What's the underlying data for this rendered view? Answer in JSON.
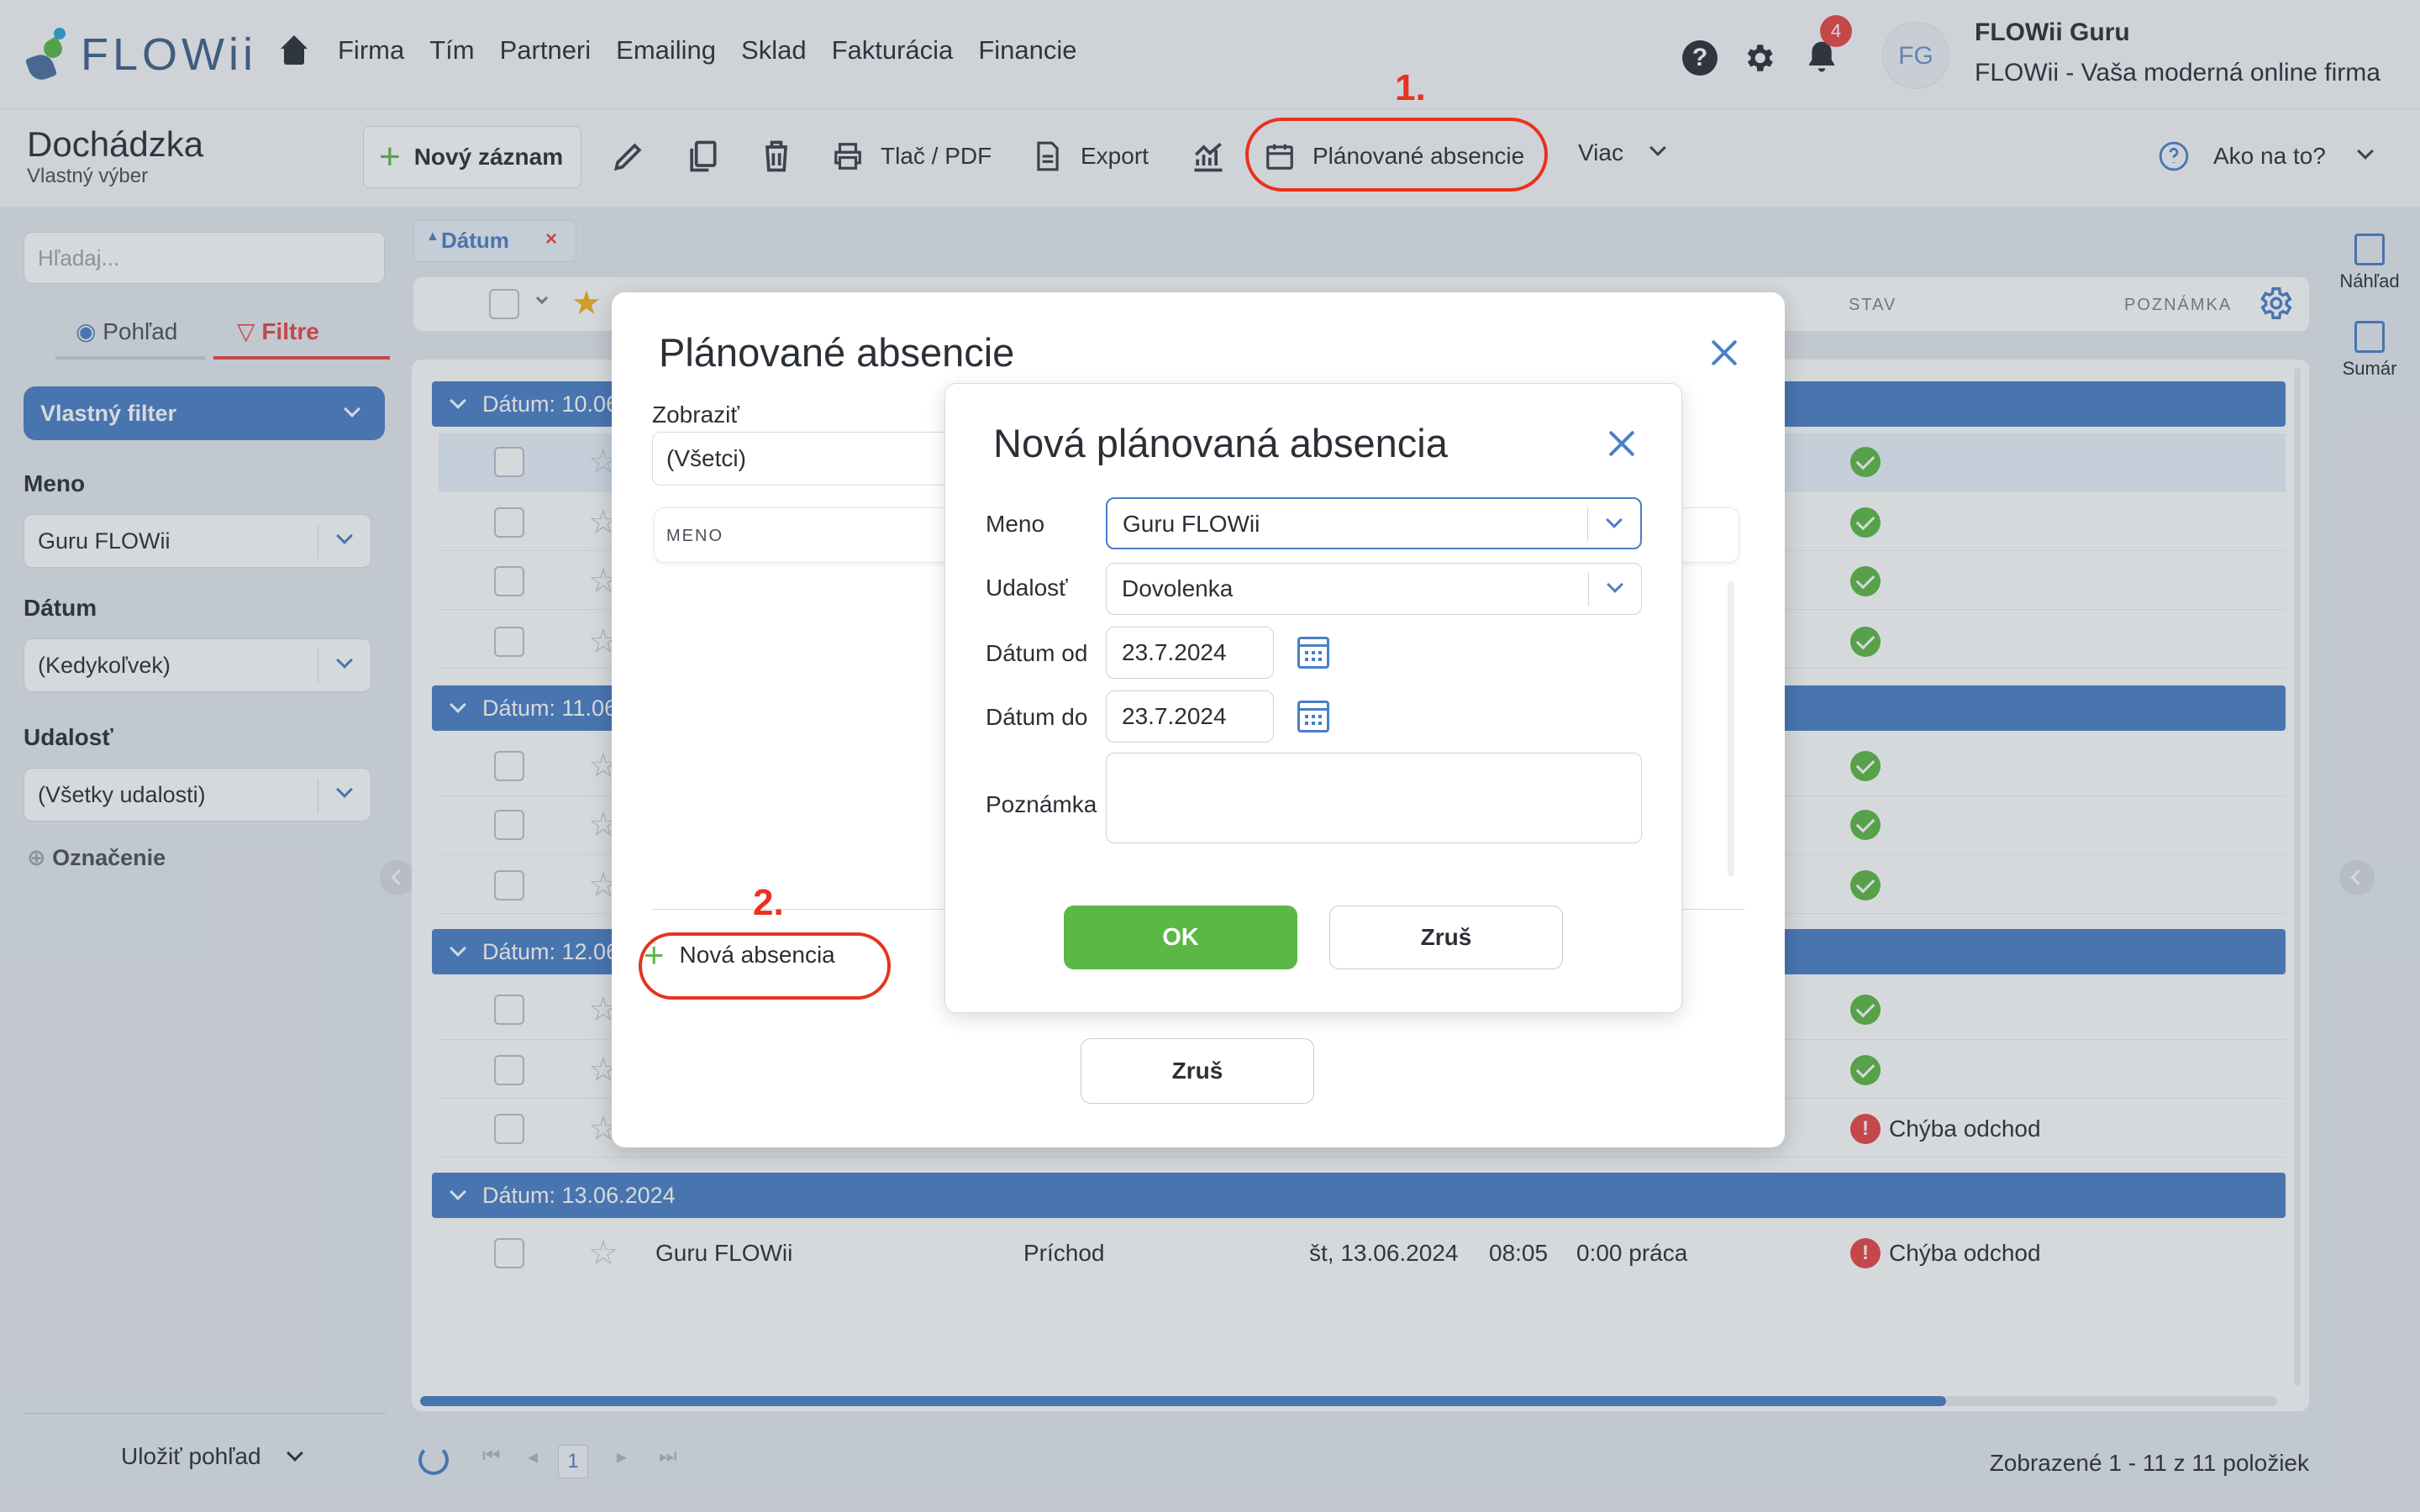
{
  "brand": {
    "logo_text": "FLOWii"
  },
  "nav": {
    "items": [
      "Firma",
      "Tím",
      "Partneri",
      "Emailing",
      "Sklad",
      "Fakturácia",
      "Financie"
    ]
  },
  "user": {
    "notifications": "4",
    "initials": "FG",
    "name": "FLOWii Guru",
    "company": "FLOWii - Vaša moderná online firma"
  },
  "page": {
    "title": "Dochádzka",
    "subtitle": "Vlastný výber"
  },
  "toolbar": {
    "new_record": "Nový záznam",
    "print": "Tlač / PDF",
    "export": "Export",
    "planned_absences": "Plánované absencie",
    "more": "Viac",
    "help": "Ako na to?"
  },
  "annotations": {
    "step1": "1.",
    "step2": "2."
  },
  "sidebar": {
    "search_placeholder": "Hľadaj...",
    "tab_view": "Pohľad",
    "tab_filters": "Filtre",
    "filter_select": "Vlastný filter",
    "fields": [
      {
        "label": "Meno",
        "value": "Guru FLOWii"
      },
      {
        "label": "Dátum",
        "value": "(Kedykoľvek)"
      },
      {
        "label": "Udalosť",
        "value": "(Všetky udalosti)"
      }
    ],
    "marking": "Označenie",
    "save_view": "Uložiť pohľad"
  },
  "list": {
    "filter_chip": "Dátum",
    "filter_chip_remove": "×",
    "columns": {
      "stav": "STAV",
      "poznamka": "POZNÁMKA"
    },
    "groups": [
      {
        "label": "Dátum: 10.06"
      },
      {
        "label": "Dátum: 11.06"
      },
      {
        "label": "Dátum: 12.06"
      },
      {
        "label": "Dátum: 13.06.2024"
      }
    ],
    "error_text": "Chýba odchod",
    "last_row": {
      "name": "Guru FLOWii",
      "event": "Príchod",
      "date": "št, 13.06.2024",
      "time": "08:05",
      "work": "0:00 práca",
      "status": "Chýba odchod"
    },
    "page_current": "1",
    "summary": "Zobrazené 1 - 11 z 11 položiek"
  },
  "right_rail": {
    "preview": "Náhľad",
    "summary": "Sumár"
  },
  "dialog_planned": {
    "title": "Plánované absencie",
    "show_label": "Zobraziť",
    "show_value": "(Všetci)",
    "col_name": "MENO",
    "new_absence": "Nová absencia",
    "cancel": "Zruš"
  },
  "dialog_new": {
    "title": "Nová plánovaná absencia",
    "fields": {
      "name_label": "Meno",
      "name_value": "Guru FLOWii",
      "event_label": "Udalosť",
      "event_value": "Dovolenka",
      "from_label": "Dátum od",
      "from_value": "23.7.2024",
      "to_label": "Dátum do",
      "to_value": "23.7.2024",
      "note_label": "Poznámka"
    },
    "ok": "OK",
    "cancel": "Zruš"
  },
  "colors": {
    "accent": "#4a7fc6",
    "success": "#5bb845",
    "danger": "#e84545",
    "annotation": "#e8321f"
  }
}
